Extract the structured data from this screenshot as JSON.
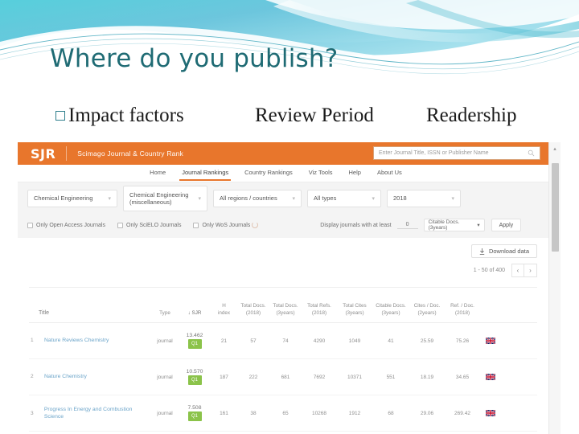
{
  "slide": {
    "title": "Where do you publish?",
    "bullets": [
      {
        "text": "Impact factors",
        "has_square_bullet": true
      },
      {
        "text": "Review Period",
        "has_square_bullet": false
      },
      {
        "text": "Readership",
        "has_square_bullet": false
      }
    ],
    "title_color": "#1f6b74"
  },
  "sjr": {
    "brand": "SJR",
    "brand_subtitle": "Scimago Journal & Country Rank",
    "brand_color": "#e8762c",
    "search": {
      "placeholder": "Enter Journal Title, ISSN or Publisher Name",
      "value": "",
      "icon": "search-icon"
    },
    "nav": [
      {
        "label": "Home",
        "active": false
      },
      {
        "label": "Journal Rankings",
        "active": true
      },
      {
        "label": "Country Rankings",
        "active": false
      },
      {
        "label": "Viz Tools",
        "active": false
      },
      {
        "label": "Help",
        "active": false
      },
      {
        "label": "About Us",
        "active": false
      }
    ],
    "filters": [
      {
        "name": "subject-area",
        "value": "Chemical Engineering"
      },
      {
        "name": "subject-category",
        "value": "Chemical Engineering (miscellaneous)"
      },
      {
        "name": "region",
        "value": "All regions / countries"
      },
      {
        "name": "type",
        "value": "All types"
      },
      {
        "name": "year",
        "value": "2018"
      }
    ],
    "checkboxes": [
      {
        "label": "Only Open Access Journals",
        "checked": false
      },
      {
        "label": "Only SciELO Journals",
        "checked": false
      },
      {
        "label": "Only WoS Journals",
        "checked": false
      }
    ],
    "display_filter": {
      "label": "Display journals with at least",
      "value": "0",
      "metric": "Citable Docs. (3years)",
      "apply_label": "Apply"
    },
    "download_label": "Download data",
    "download_icon": "download-icon",
    "pagination": {
      "range": "1 - 50 of 400",
      "prev": "‹",
      "next": "›"
    },
    "table": {
      "headers": [
        "Title",
        "Type",
        "↓ SJR",
        "H index",
        "Total Docs. (2018)",
        "Total Docs. (3years)",
        "Total Refs. (2018)",
        "Total Cites (3years)",
        "Citable Docs. (3years)",
        "Cites / Doc. (2years)",
        "Ref. / Doc. (2018)"
      ],
      "headers_split": [
        {
          "l1": "Title",
          "l2": ""
        },
        {
          "l1": "Type",
          "l2": ""
        },
        {
          "l1": "↓ SJR",
          "l2": ""
        },
        {
          "l1": "H",
          "l2": "index"
        },
        {
          "l1": "Total Docs.",
          "l2": "(2018)"
        },
        {
          "l1": "Total Docs.",
          "l2": "(3years)"
        },
        {
          "l1": "Total Refs.",
          "l2": "(2018)"
        },
        {
          "l1": "Total Cites",
          "l2": "(3years)"
        },
        {
          "l1": "Citable Docs.",
          "l2": "(3years)"
        },
        {
          "l1": "Cites / Doc.",
          "l2": "(2years)"
        },
        {
          "l1": "Ref. / Doc.",
          "l2": "(2018)"
        }
      ],
      "rows": [
        {
          "rank": "1",
          "title": "Nature Reviews Chemistry",
          "type": "journal",
          "sjr": "13.462",
          "quartile": "Q1",
          "h_index": "21",
          "total_docs_2018": "57",
          "total_docs_3y": "74",
          "total_refs_2018": "4290",
          "total_cites_3y": "1049",
          "citable_docs_3y": "41",
          "cites_per_doc_2y": "25.59",
          "refs_per_doc_2018": "75.26",
          "country": "GB"
        },
        {
          "rank": "2",
          "title": "Nature Chemistry",
          "type": "journal",
          "sjr": "10.570",
          "quartile": "Q1",
          "h_index": "187",
          "total_docs_2018": "222",
          "total_docs_3y": "681",
          "total_refs_2018": "7692",
          "total_cites_3y": "10371",
          "citable_docs_3y": "551",
          "cites_per_doc_2y": "18.19",
          "refs_per_doc_2018": "34.65",
          "country": "GB"
        },
        {
          "rank": "3",
          "title": "Progress In Energy and Combustion Science",
          "type": "journal",
          "sjr": "7.508",
          "quartile": "Q1",
          "h_index": "161",
          "total_docs_2018": "38",
          "total_docs_3y": "65",
          "total_refs_2018": "10268",
          "total_cites_3y": "1912",
          "citable_docs_3y": "68",
          "cites_per_doc_2y": "29.06",
          "refs_per_doc_2018": "269.42",
          "country": "GB"
        }
      ]
    }
  }
}
